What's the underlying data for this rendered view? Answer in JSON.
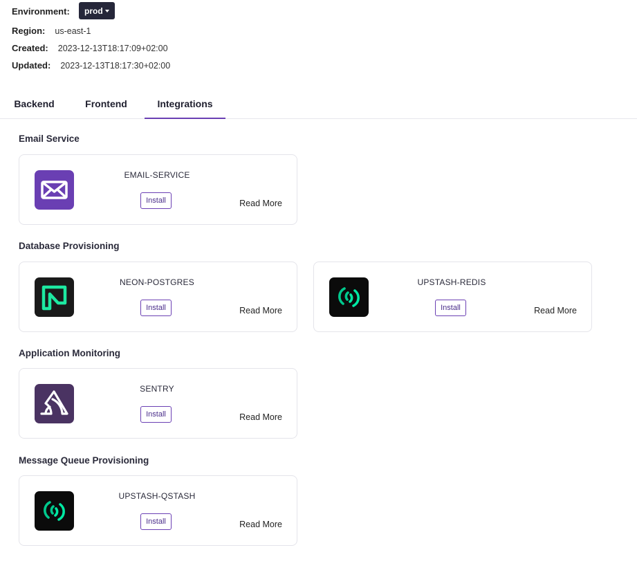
{
  "meta": {
    "environment_label": "Environment:",
    "environment_value": "prod",
    "region_label": "Region:",
    "region_value": "us-east-1",
    "created_label": "Created:",
    "created_value": "2023-12-13T18:17:09+02:00",
    "updated_label": "Updated:",
    "updated_value": "2023-12-13T18:17:30+02:00"
  },
  "tabs": [
    {
      "label": "Backend",
      "active": false
    },
    {
      "label": "Frontend",
      "active": false
    },
    {
      "label": "Integrations",
      "active": true
    }
  ],
  "sections": [
    {
      "title": "Email Service",
      "cards": [
        {
          "name": "EMAIL-SERVICE",
          "install": "Install",
          "read_more": "Read More",
          "icon": "envelope-icon",
          "color": "#6a3fb3"
        }
      ]
    },
    {
      "title": "Database Provisioning",
      "cards": [
        {
          "name": "NEON-POSTGRES",
          "install": "Install",
          "read_more": "Read More",
          "icon": "neon-logo-icon",
          "color": "#1a1a1a"
        },
        {
          "name": "UPSTASH-REDIS",
          "install": "Install",
          "read_more": "Read More",
          "icon": "upstash-logo-icon",
          "color": "#0b0b0b"
        }
      ]
    },
    {
      "title": "Application Monitoring",
      "cards": [
        {
          "name": "SENTRY",
          "install": "Install",
          "read_more": "Read More",
          "icon": "sentry-logo-icon",
          "color": "#4a3362"
        }
      ]
    },
    {
      "title": "Message Queue Provisioning",
      "cards": [
        {
          "name": "UPSTASH-QSTASH",
          "install": "Install",
          "read_more": "Read More",
          "icon": "upstash-logo-icon",
          "color": "#0b0b0b"
        }
      ]
    }
  ],
  "colors": {
    "accent": "#6a3fb3",
    "env_button_bg": "#26273a",
    "upstash_green": "#00e9a3"
  }
}
